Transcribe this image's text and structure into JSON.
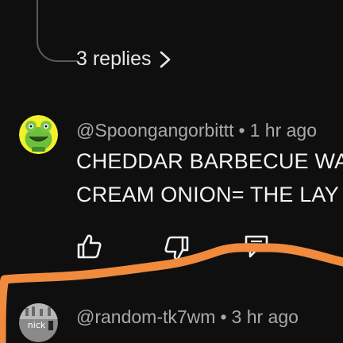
{
  "colors": {
    "background": "#0f0f0f",
    "text_primary": "#f4f4f4",
    "text_secondary": "#a9a9a9",
    "annotation_stroke": "#f08a3c",
    "avatar_green": "#7cc44a"
  },
  "replies": {
    "label": "3 replies",
    "icon": "chevron-right-icon"
  },
  "comments": [
    {
      "username": "@Spoongangorbittt",
      "separator": "•",
      "time": "1 hr ago",
      "lines": [
        "CHEDDAR BARBECUE WA",
        "CREAM ONION= THE LAY"
      ],
      "avatar": "green-frog-avatar",
      "actions": [
        "like-icon",
        "dislike-icon",
        "reply-icon"
      ]
    },
    {
      "username": "@random-tk7wm",
      "separator": "•",
      "time": "3 hr ago",
      "avatar": "gray-avatar",
      "avatar_text": "nick"
    }
  ]
}
